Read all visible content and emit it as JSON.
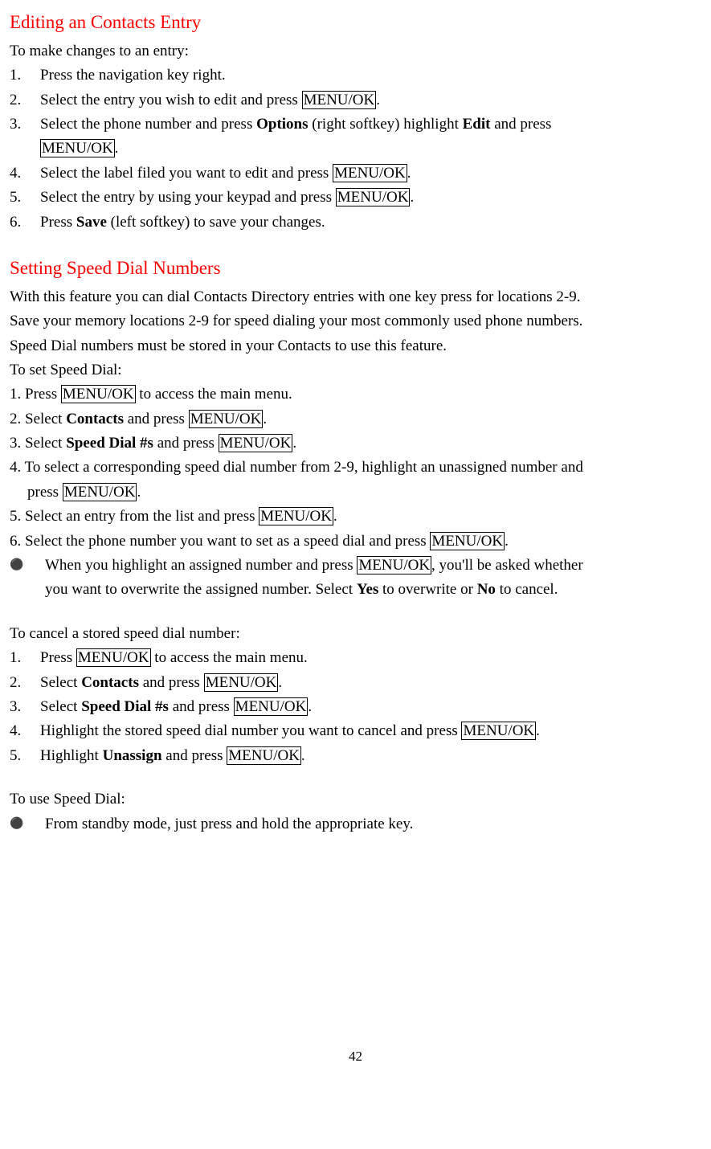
{
  "section1": {
    "heading": "Editing an Contacts Entry",
    "intro": "To make changes to an entry:",
    "items": [
      {
        "num": "1.",
        "pre": "Press the navigation key right."
      },
      {
        "num": "2.",
        "pre": "Select the entry you wish to edit and press ",
        "key": "MENU/OK",
        "post": "."
      },
      {
        "num": "3.",
        "pre": "Select the phone number and press ",
        "bold1": "Options",
        "mid": " (right softkey) highlight ",
        "bold2": "Edit",
        "post": " and press",
        "line2key": "MENU/OK",
        "line2post": "."
      },
      {
        "num": "4.",
        "pre": "Select the label filed you want to edit and press ",
        "key": "MENU/OK",
        "post": "."
      },
      {
        "num": "5.",
        "pre": "Select the entry by using your keypad and press ",
        "key": "MENU/OK",
        "post": "."
      },
      {
        "num": "6.",
        "pre": "Press ",
        "bold1": "Save",
        "post2": " (left softkey) to save your changes."
      }
    ]
  },
  "section2": {
    "heading": "Setting Speed Dial Numbers",
    "p1": "With this feature you can dial Contacts Directory entries with one key press for locations 2-9.",
    "p2": "Save your memory locations 2-9 for speed dialing your most commonly used phone numbers.",
    "p3": "Speed Dial numbers must be stored in your Contacts to use this feature.",
    "intro": "To set Speed Dial:",
    "items": [
      {
        "text_pre": "1. Press ",
        "key": "MENU/OK",
        "post": " to access the main menu."
      },
      {
        "text_pre": "2. Select ",
        "bold": "Contacts",
        "mid": " and press ",
        "key": "MENU/OK",
        "post": "."
      },
      {
        "text_pre": "3. Select ",
        "bold": "Speed Dial #s",
        "mid": " and press ",
        "key": "MENU/OK",
        "post": "."
      },
      {
        "text_pre": "4. To select a corresponding speed dial number from 2-9, highlight an unassigned number and",
        "line2pre": "press ",
        "line2key": "MENU/OK",
        "line2post": "."
      },
      {
        "text_pre": "5. Select an entry from the list and press ",
        "key": "MENU/OK",
        "post": "."
      },
      {
        "text_pre": "6. Select the phone number you want to set as a speed dial and press ",
        "key": "MENU/OK",
        "post": "."
      }
    ],
    "bullet": {
      "pre": "When you highlight an assigned number and press ",
      "key": "MENU/OK",
      "mid": ", you'll be asked whether",
      "line2": "you want to overwrite the assigned number. Select ",
      "bold1": "Yes",
      "mid2": " to overwrite or ",
      "bold2": "No",
      "post": " to cancel."
    }
  },
  "section3": {
    "intro": "To cancel a stored speed dial number:",
    "items": [
      {
        "num": "1.",
        "pre": "Press ",
        "key": "MENU/OK",
        "post": " to access the main menu."
      },
      {
        "num": "2.",
        "pre": "Select ",
        "bold": "Contacts",
        "mid": " and press ",
        "key": "MENU/OK",
        "post": "."
      },
      {
        "num": "3.",
        "pre": "Select ",
        "bold": "Speed Dial #s",
        "mid": " and press ",
        "key": "MENU/OK",
        "post": "."
      },
      {
        "num": "4.",
        "pre": "Highlight the stored speed dial number you want to cancel and press ",
        "key": "MENU/OK",
        "post": "."
      },
      {
        "num": "5.",
        "pre": "Highlight ",
        "bold": "Unassign",
        "mid": " and press ",
        "key": "MENU/OK",
        "post": "."
      }
    ]
  },
  "section4": {
    "intro": "To use Speed Dial:",
    "bullet": "From standby mode, just press and hold the appropriate key."
  },
  "pageNum": "42"
}
